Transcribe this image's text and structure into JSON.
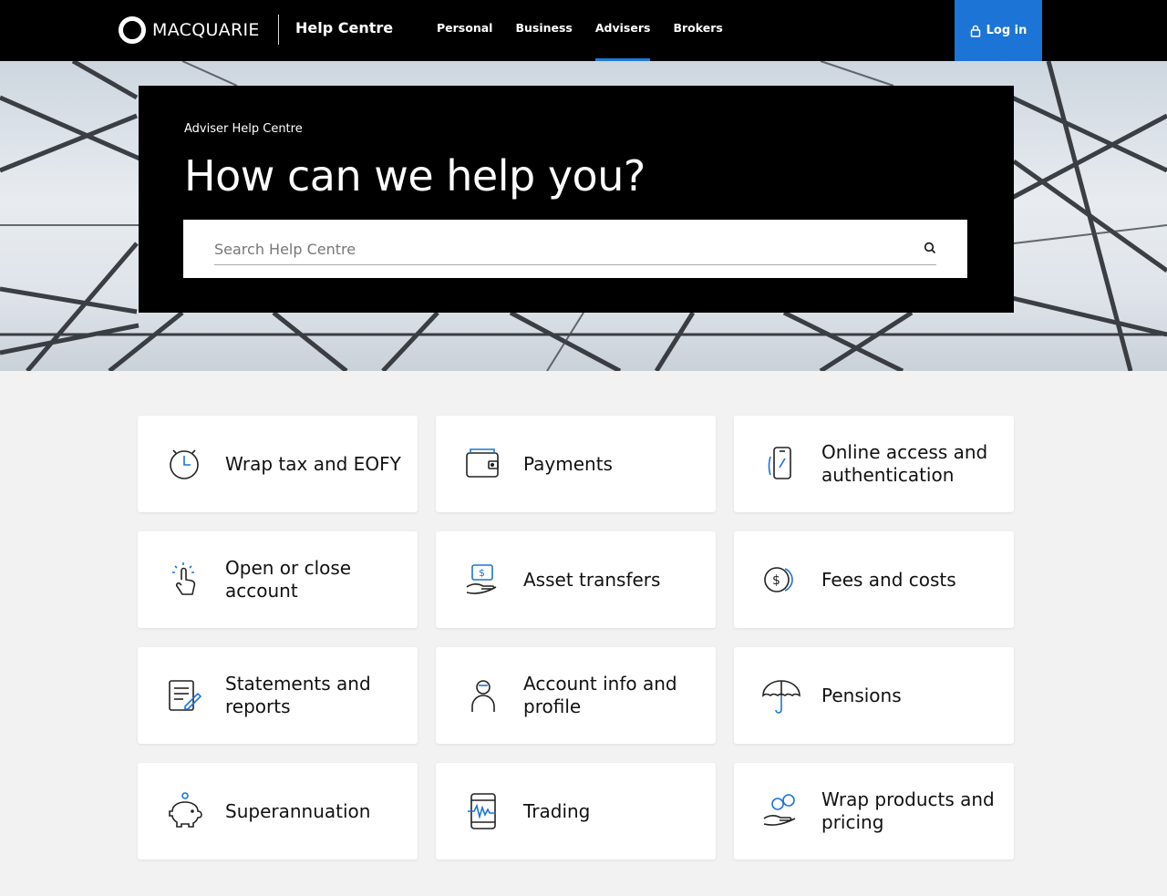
{
  "header": {
    "brand_name": "MACQUARIE",
    "site_name": "Help Centre",
    "nav": [
      "Personal",
      "Business",
      "Advisers",
      "Brokers"
    ],
    "active_nav": "Advisers",
    "login_label": "Log in"
  },
  "hero": {
    "kicker": "Adviser Help Centre",
    "title": "How can we help you?",
    "search_placeholder": "Search Help Centre"
  },
  "topics": [
    {
      "label": "Wrap tax and EOFY",
      "icon": "clock-calendar-icon"
    },
    {
      "label": "Payments",
      "icon": "wallet-icon"
    },
    {
      "label": "Online access and authentication",
      "icon": "mobile-phone-icon"
    },
    {
      "label": "Open or close account",
      "icon": "hand-pointer-icon"
    },
    {
      "label": "Asset transfers",
      "icon": "hand-dollar-icon"
    },
    {
      "label": "Fees and costs",
      "icon": "coins-icon"
    },
    {
      "label": "Statements and reports",
      "icon": "document-pen-icon"
    },
    {
      "label": "Account info and profile",
      "icon": "person-icon"
    },
    {
      "label": "Pensions",
      "icon": "umbrella-icon"
    },
    {
      "label": "Superannuation",
      "icon": "piggy-bank-icon"
    },
    {
      "label": "Trading",
      "icon": "stock-chart-icon"
    },
    {
      "label": "Wrap products and pricing",
      "icon": "hand-coins-icon"
    }
  ],
  "colors": {
    "accent_blue": "#1c74d6",
    "nav_background": "#000000",
    "page_background": "#f2f2f2"
  }
}
